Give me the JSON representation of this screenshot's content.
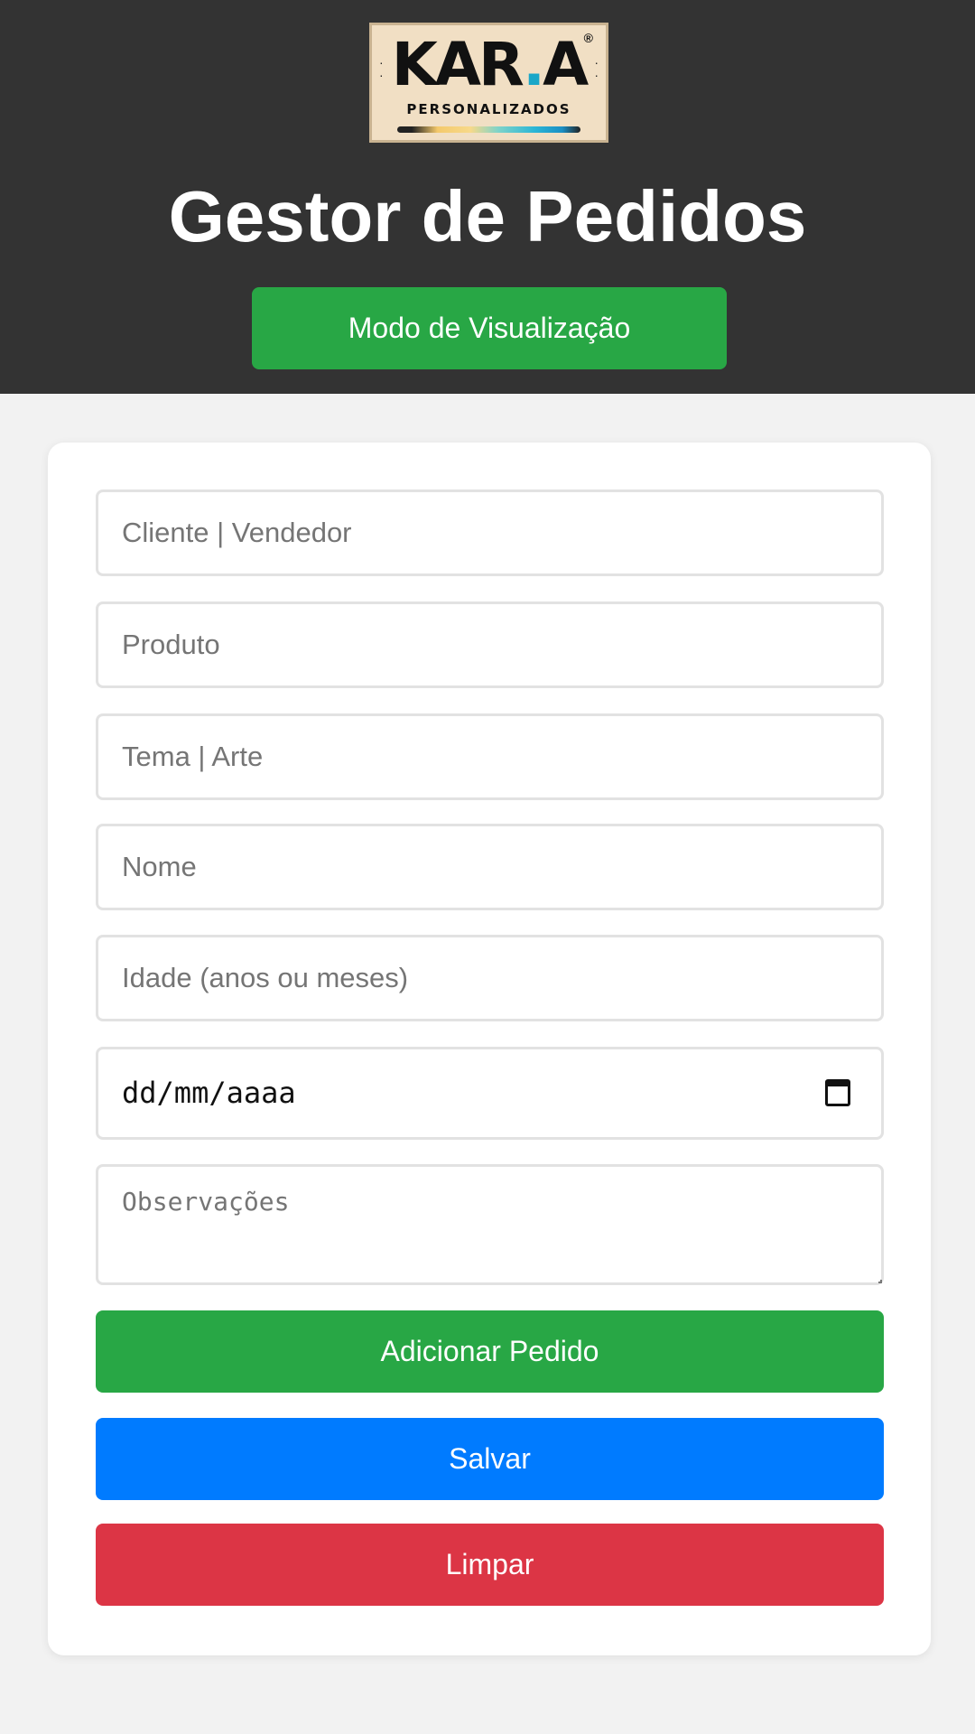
{
  "header": {
    "logo": {
      "word_main": "KAR",
      "word_dot": ".",
      "word_accent": "A",
      "registered": "®",
      "subtitle": "PERSONALIZADOS"
    },
    "title": "Gestor de Pedidos",
    "mode_button_label": "Modo de Visualização"
  },
  "form": {
    "fields": {
      "client_placeholder": "Cliente | Vendedor",
      "product_placeholder": "Produto",
      "theme_placeholder": "Tema | Arte",
      "name_placeholder": "Nome",
      "age_placeholder": "Idade (anos ou meses)",
      "date_placeholder": "dd/mm/aaaa",
      "notes_placeholder": "Observações"
    },
    "buttons": {
      "add_label": "Adicionar Pedido",
      "save_label": "Salvar",
      "clear_label": "Limpar"
    }
  },
  "colors": {
    "header_bg": "#333333",
    "page_bg": "#f2f2f2",
    "green": "#28a745",
    "blue": "#007bff",
    "red": "#dc3545"
  },
  "icons": {
    "date_picker": "calendar-icon"
  }
}
